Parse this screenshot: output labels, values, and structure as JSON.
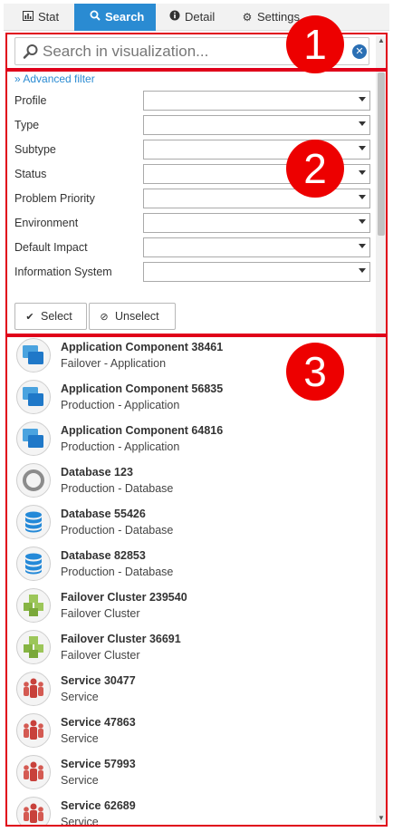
{
  "tabs": [
    {
      "label": "Stat",
      "icon": "bar-chart-icon"
    },
    {
      "label": "Search",
      "icon": "search-icon"
    },
    {
      "label": "Detail",
      "icon": "info-icon"
    },
    {
      "label": "Settings",
      "icon": "gear-icon"
    }
  ],
  "active_tab": "Search",
  "accent_color": "#2a8bd2",
  "annotation_color": "#ed0000",
  "annotations": [
    "1",
    "2",
    "3"
  ],
  "search": {
    "placeholder": "Search in visualization...",
    "value": ""
  },
  "filter": {
    "advanced_link": "» Advanced filter",
    "fields": [
      {
        "label": "Profile",
        "value": ""
      },
      {
        "label": "Type",
        "value": ""
      },
      {
        "label": "Subtype",
        "value": ""
      },
      {
        "label": "Status",
        "value": ""
      },
      {
        "label": "Problem Priority",
        "value": ""
      },
      {
        "label": "Environment",
        "value": ""
      },
      {
        "label": "Default Impact",
        "value": ""
      },
      {
        "label": "Information System",
        "value": ""
      }
    ],
    "select_label": "Select",
    "unselect_label": "Unselect"
  },
  "results": [
    {
      "title": "Application Component 38461",
      "subtitle": "Failover - Application",
      "icon": "application-component-icon"
    },
    {
      "title": "Application Component 56835",
      "subtitle": "Production - Application",
      "icon": "application-component-icon"
    },
    {
      "title": "Application Component 64816",
      "subtitle": "Production - Application",
      "icon": "application-component-icon"
    },
    {
      "title": "Database 123",
      "subtitle": "Production - Database",
      "icon": "database-ring-icon"
    },
    {
      "title": "Database 55426",
      "subtitle": "Production - Database",
      "icon": "database-icon"
    },
    {
      "title": "Database 82853",
      "subtitle": "Production - Database",
      "icon": "database-icon"
    },
    {
      "title": "Failover Cluster 239540",
      "subtitle": "Failover Cluster",
      "icon": "cluster-icon"
    },
    {
      "title": "Failover Cluster 36691",
      "subtitle": "Failover Cluster",
      "icon": "cluster-icon"
    },
    {
      "title": "Service 30477",
      "subtitle": "Service",
      "icon": "service-icon"
    },
    {
      "title": "Service 47863",
      "subtitle": "Service",
      "icon": "service-icon"
    },
    {
      "title": "Service 57993",
      "subtitle": "Service",
      "icon": "service-icon"
    },
    {
      "title": "Service 62689",
      "subtitle": "Service",
      "icon": "service-icon"
    }
  ]
}
